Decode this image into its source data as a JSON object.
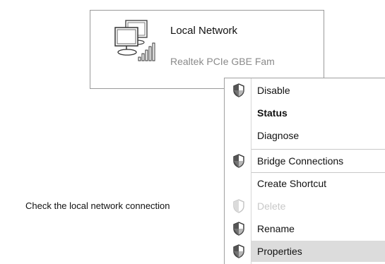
{
  "network": {
    "name": "Local Network",
    "device": "Realtek PCIe GBE Fam"
  },
  "caption": "Check the local network connection",
  "menu": {
    "items": [
      {
        "label": "Disable",
        "shield": true
      },
      {
        "label": "Status",
        "bold": true
      },
      {
        "label": "Diagnose"
      },
      {
        "label": "Bridge Connections",
        "shield": true
      },
      {
        "label": "Create Shortcut"
      },
      {
        "label": "Delete",
        "shield": true,
        "disabled": true
      },
      {
        "label": "Rename",
        "shield": true
      },
      {
        "label": "Properties",
        "shield": true,
        "highlighted": true
      }
    ]
  }
}
